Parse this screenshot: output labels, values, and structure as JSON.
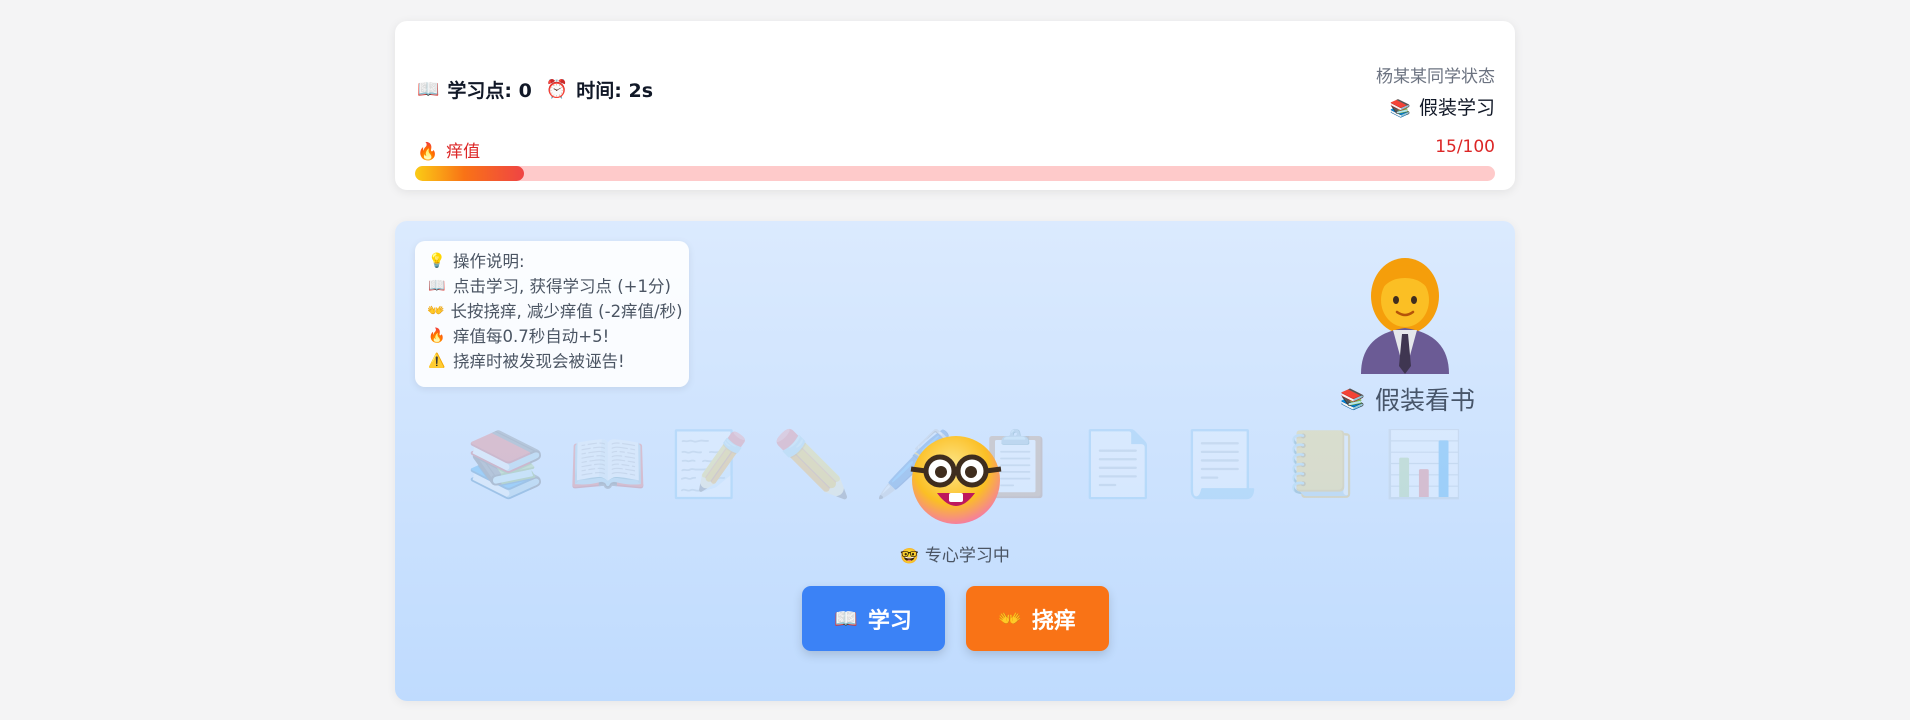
{
  "header": {
    "points_icon": "open-book-icon",
    "points_text": "学习点: 0",
    "time_icon": "alarm-clock-icon",
    "time_text": "时间: 2s",
    "state_title": "杨某某同学状态",
    "state_icon": "books-icon",
    "state_value": "假装学习"
  },
  "itch": {
    "icon": "fire-icon",
    "label": "痒值",
    "value_text": "15/100",
    "level": 0.15,
    "bar_color": "#ef4444",
    "track_color": "#fecaca"
  },
  "instructions": {
    "title_icon": "light-bulb-icon",
    "title": "操作说明:",
    "lines": [
      {
        "icon": "open-book-icon",
        "text": "点击学习, 获得学习点 (+1分)"
      },
      {
        "icon": "palms-up-icon",
        "text": "长按挠痒, 减少痒值 (-2痒值/秒)"
      },
      {
        "icon": "fire-icon",
        "text": "痒值每0.7秒自动+5!"
      },
      {
        "icon": "warning-icon",
        "text": "挠痒时被发现会被诬告!"
      }
    ]
  },
  "teacher": {
    "icon": "teacher-icon",
    "label_icon": "books-icon",
    "label": "假装看书"
  },
  "background_icons": [
    "books-icon",
    "open-book-icon",
    "document-pen-icon",
    "pencil-icon",
    "pen-icon",
    "clipboard-icon",
    "page-icon",
    "page-lines-icon",
    "notebook-icon",
    "bar-chart-icon"
  ],
  "student": {
    "icon": "nerd-face-icon",
    "status_icon": "nerd-face-icon",
    "status": "专心学习中"
  },
  "buttons": {
    "study_icon": "open-book-icon",
    "study_label": "学习",
    "study_color": "#3b82f6",
    "scratch_icon": "raised-hands-icon",
    "scratch_label": "挠痒",
    "scratch_color": "#f97316"
  }
}
